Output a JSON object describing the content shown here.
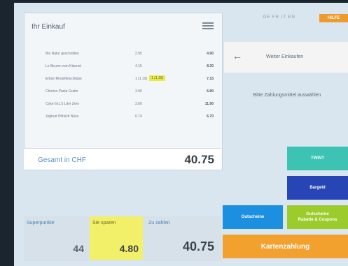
{
  "cart": {
    "title": "Ihr Einkauf",
    "items": [
      {
        "name": "Bio Natur geschnitten",
        "qty": "2.95",
        "discount": "",
        "price": "4.90"
      },
      {
        "name": "Le Beurre vom Käserei",
        "qty": "4.15",
        "discount": "",
        "price": "8.30"
      },
      {
        "name": "Erbse Rindsfleischkäse",
        "qty": "1 (1.19)",
        "discount": "1 (1.19)",
        "price": "7.15"
      },
      {
        "name": "Chorizo Pasta Gratin",
        "qty": "3.90",
        "discount": "",
        "price": "6.80"
      },
      {
        "name": "Coke 6x1.5 Liter Zero",
        "qty": "3.60",
        "discount": "",
        "price": "11.90"
      },
      {
        "name": "Joghurt Pfirsich Nüss",
        "qty": "0.74",
        "discount": "",
        "price": "6.70"
      }
    ],
    "total_label": "Gesamt in CHF",
    "total_value": "40.75"
  },
  "summary": {
    "superpunkte_label": "Superpunkte",
    "superpunkte_value": "44",
    "savings_label": "Sie sparen",
    "savings_value": "4.80",
    "to_pay_label": "Zu zahlen",
    "to_pay_value": "40.75"
  },
  "header": {
    "languages": "DE  FR  IT  EN",
    "help_label": "HILFE"
  },
  "continue": {
    "back_icon": "←",
    "label": "Weiter Einkaufen"
  },
  "instruction": "Bitte Zahlungsmittel auswählen",
  "payment": {
    "twint": "TWINT",
    "bargeld": "Bargeld",
    "gutscheine": "Gutscheine",
    "discount_line1": "Gutscheine",
    "discount_line2": "Rabatte & Coupons",
    "card": "Kartenzahlung"
  },
  "colors": {
    "twint": "#3cc3b4",
    "bargeld": "#2745b5",
    "gutscheine": "#1d8fe0",
    "discount": "#9ccb2c",
    "card": "#f2a12f",
    "help": "#ef9b2c",
    "savings": "#f1f068"
  }
}
